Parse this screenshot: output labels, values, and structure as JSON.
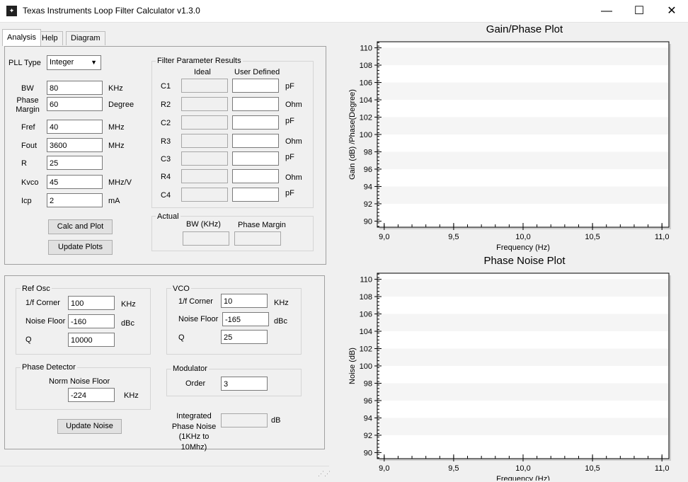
{
  "window": {
    "title": "Texas Instruments Loop Filter Calculator v1.3.0",
    "logo": "ti-logo-icon",
    "controls": {
      "minimize": "—",
      "maximize": "☐",
      "close": "✕"
    }
  },
  "tabs": [
    "Analysis",
    "Help",
    "Diagram"
  ],
  "loop": {
    "pll_type_label": "PLL Type",
    "pll_type_value": "Integer",
    "inputs": [
      {
        "label": "BW",
        "value": "80",
        "unit": "KHz"
      },
      {
        "label": "Phase\nMargin",
        "value": "60",
        "unit": "Degree"
      },
      {
        "label": "Fref",
        "value": "40",
        "unit": "MHz"
      },
      {
        "label": "Fout",
        "value": "3600",
        "unit": "MHz"
      },
      {
        "label": "R",
        "value": "25",
        "unit": ""
      },
      {
        "label": "Kvco",
        "value": "45",
        "unit": "MHz/V"
      },
      {
        "label": "Icp",
        "value": "2",
        "unit": "mA"
      }
    ],
    "calc_button": "Calc and Plot",
    "update_plots_button": "Update Plots"
  },
  "filter": {
    "group_title": "Filter Parameter Results",
    "col_ideal": "Ideal",
    "col_user": "User Defined",
    "rows": [
      {
        "label": "C1",
        "ideal": "",
        "user": "",
        "unit": "pF"
      },
      {
        "label": "R2",
        "ideal": "",
        "user": "",
        "unit": "Ohm"
      },
      {
        "label": "C2",
        "ideal": "",
        "user": "",
        "unit": "pF"
      },
      {
        "label": "R3",
        "ideal": "",
        "user": "",
        "unit": "Ohm"
      },
      {
        "label": "C3",
        "ideal": "",
        "user": "",
        "unit": "pF"
      },
      {
        "label": "R4",
        "ideal": "",
        "user": "",
        "unit": "Ohm"
      },
      {
        "label": "C4",
        "ideal": "",
        "user": "",
        "unit": "pF"
      }
    ],
    "actual_title": "Actual",
    "actual_bw_label": "BW (KHz)",
    "actual_pm_label": "Phase Margin",
    "actual_bw": "",
    "actual_pm": ""
  },
  "noise": {
    "ref_osc": {
      "title": "Ref Osc",
      "corner_label": "1/f Corner",
      "corner_value": "100",
      "corner_unit": "KHz",
      "floor_label": "Noise Floor",
      "floor_value": "-160",
      "floor_unit": "dBc",
      "q_label": "Q",
      "q_value": "10000"
    },
    "vco": {
      "title": "VCO",
      "corner_label": "1/f Corner",
      "corner_value": "10",
      "corner_unit": "KHz",
      "floor_label": "Noise Floor",
      "floor_value": "-165",
      "floor_unit": "dBc",
      "q_label": "Q",
      "q_value": "25"
    },
    "phase_detector": {
      "title": "Phase Detector",
      "floor_label": "Norm Noise Floor",
      "floor_value": "-224",
      "floor_unit": "KHz"
    },
    "modulator": {
      "title": "Modulator",
      "order_label": "Order",
      "order_value": "3"
    },
    "update_button": "Update Noise",
    "integrated_label": "Integrated\nPhase Noise\n(1KHz to 10Mhz)",
    "integrated_value": "",
    "integrated_unit": "dB"
  },
  "chart_data": [
    {
      "type": "line",
      "title": "Gain/Phase Plot",
      "xlabel": "Frequency (Hz)",
      "ylabel": "Gain (dB) /Phase(Degree)",
      "xlim": [
        8.95,
        11.05
      ],
      "ylim": [
        89.3,
        110.7
      ],
      "xticks": [
        "9,0",
        "9,5",
        "10,0",
        "10,5",
        "11,0"
      ],
      "yticks": [
        "90",
        "92",
        "94",
        "96",
        "98",
        "100",
        "102",
        "104",
        "106",
        "108",
        "110"
      ],
      "series": []
    },
    {
      "type": "line",
      "title": "Phase Noise Plot",
      "xlabel": "Frequency (Hz)",
      "ylabel": "Noise (dB)",
      "xlim": [
        8.95,
        11.05
      ],
      "ylim": [
        89.3,
        110.7
      ],
      "xticks": [
        "9,0",
        "9,5",
        "10,0",
        "10,5",
        "11,0"
      ],
      "yticks": [
        "90",
        "92",
        "94",
        "96",
        "98",
        "100",
        "102",
        "104",
        "106",
        "108",
        "110"
      ],
      "series": []
    }
  ]
}
